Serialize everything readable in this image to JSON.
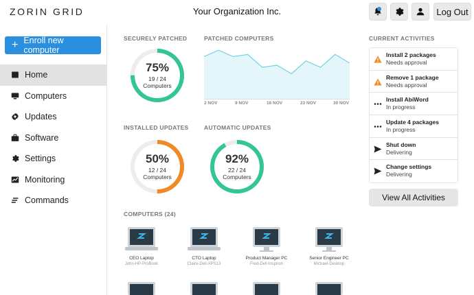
{
  "header": {
    "logo": "ZORIN GRID",
    "org": "Your Organization Inc.",
    "logout_label": "Log Out"
  },
  "sidebar": {
    "enroll_label": "Enroll new computer",
    "items": [
      {
        "label": "Home",
        "icon": "home-icon",
        "active": true
      },
      {
        "label": "Computers",
        "icon": "monitor-icon"
      },
      {
        "label": "Updates",
        "icon": "gear-badge-icon"
      },
      {
        "label": "Software",
        "icon": "briefcase-icon"
      },
      {
        "label": "Settings",
        "icon": "gear-icon"
      },
      {
        "label": "Monitoring",
        "icon": "chart-icon"
      },
      {
        "label": "Commands",
        "icon": "commands-icon"
      }
    ]
  },
  "secure": {
    "label": "SECURELY PATCHED",
    "pct": "75%",
    "count": "19 / 24",
    "unit": "Computers",
    "fraction": 0.75,
    "color": "#33c497"
  },
  "installed": {
    "label": "INSTALLED UPDATES",
    "pct": "50%",
    "count": "12 / 24",
    "unit": "Computers",
    "fraction": 0.5,
    "color": "#ef8a24"
  },
  "automatic": {
    "label": "AUTOMATIC UPDATES",
    "pct": "92%",
    "count": "22 / 24",
    "unit": "Computers",
    "fraction": 0.92,
    "color": "#33c497"
  },
  "patched_chart": {
    "label": "PATCHED COMPUTERS",
    "ticks": [
      "2 NOV",
      "9 NOV",
      "16 NOV",
      "23 NOV",
      "30 NOV"
    ],
    "values": [
      20,
      23,
      20,
      21,
      15,
      16,
      12,
      18,
      15,
      21,
      17
    ]
  },
  "activities": {
    "label": "CURRENT ACTIVITIES",
    "items": [
      {
        "title": "Install 2 packages",
        "status": "Needs approval",
        "icon": "warning-icon"
      },
      {
        "title": "Remove 1 package",
        "status": "Needs approval",
        "icon": "warning-icon"
      },
      {
        "title": "Install AbiWord",
        "status": "In progress",
        "icon": "dots-icon"
      },
      {
        "title": "Update 4 packages",
        "status": "In progress",
        "icon": "dots-icon"
      },
      {
        "title": "Shut down",
        "status": "Delivering",
        "icon": "send-icon"
      },
      {
        "title": "Change settings",
        "status": "Delivering",
        "icon": "send-icon"
      }
    ],
    "view_all": "View All Activities"
  },
  "computers": {
    "label": "COMPUTERS (24)",
    "items": [
      {
        "name": "CEO Laptop",
        "host": "John-HP-ProBook",
        "kind": "laptop"
      },
      {
        "name": "CTO Laptop",
        "host": "Claire-Dell-XPS13",
        "kind": "laptop"
      },
      {
        "name": "Product Manager PC",
        "host": "Fred-Dell-Inspiron",
        "kind": "desktop"
      },
      {
        "name": "Senior Engineer PC",
        "host": "Michael-Desktop",
        "kind": "desktop"
      }
    ]
  },
  "colors": {
    "accent": "#2b8fe0",
    "green": "#33c497",
    "orange": "#ef8a24",
    "chart_line": "#6fd0ea",
    "chart_fill": "#e5f6fb"
  }
}
